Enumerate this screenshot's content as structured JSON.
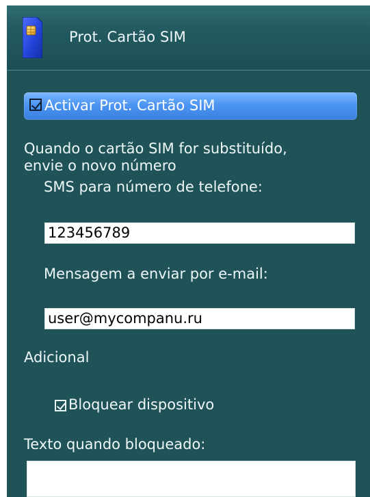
{
  "header": {
    "title": "Prot. Cartão SIM",
    "icon": "sim-card-icon"
  },
  "settings": {
    "enable_sim_protection": {
      "label": "Activar Prot. Cartão SIM",
      "checked": true
    },
    "description": {
      "line1": "Quando o cartão SIM for substituído,",
      "line2": "envie o novo número"
    },
    "sms": {
      "label": "SMS para número de telefone:",
      "value": "123456789"
    },
    "email": {
      "label": "Mensagem a enviar por e-mail:",
      "value": "user@mycompanu.ru"
    },
    "additional": {
      "label": "Adicional"
    },
    "lock_device": {
      "label": "Bloquear dispositivo",
      "checked": true
    },
    "lock_text": {
      "label": "Texto quando bloqueado:",
      "value": ""
    }
  },
  "colors": {
    "background": "#1f5358",
    "header": "#235b61",
    "selection": "#4c95f2",
    "text": "#eef7f8"
  }
}
